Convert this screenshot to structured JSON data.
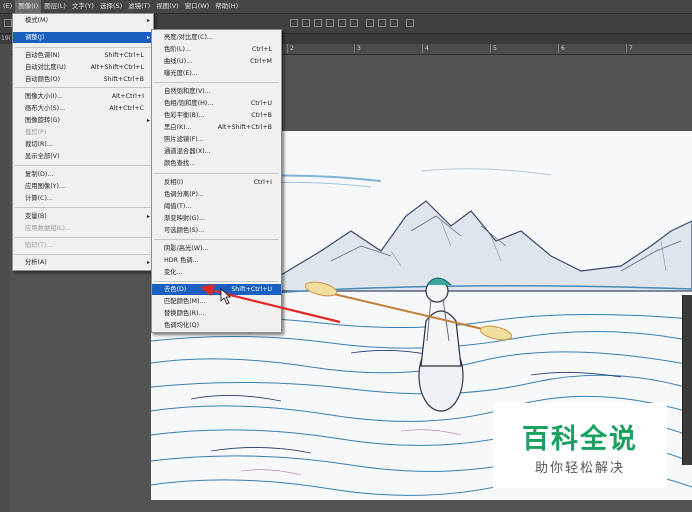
{
  "menubar": {
    "items": [
      {
        "label": "(E)"
      },
      {
        "label": "图像(I)"
      },
      {
        "label": "图层(L)"
      },
      {
        "label": "文字(Y)"
      },
      {
        "label": "选择(S)"
      },
      {
        "label": "滤镜(T)"
      },
      {
        "label": "视图(V)"
      },
      {
        "label": "窗口(W)"
      },
      {
        "label": "帮助(H)"
      }
    ]
  },
  "tab_label": "19(",
  "ruler_labels": [
    "2",
    "3",
    "4",
    "5",
    "6",
    "7"
  ],
  "image_menu": {
    "items": [
      {
        "label": "模式(M)",
        "shortcut": "",
        "submenu": true
      },
      {
        "label": "调整(J)",
        "shortcut": "",
        "submenu": true,
        "highlighted": true
      },
      {
        "label": "自动色调(N)",
        "shortcut": "Shift+Ctrl+L"
      },
      {
        "label": "自动对比度(U)",
        "shortcut": "Alt+Shift+Ctrl+L"
      },
      {
        "label": "自动颜色(O)",
        "shortcut": "Shift+Ctrl+B"
      },
      {
        "label": "图像大小(I)...",
        "shortcut": "Alt+Ctrl+I"
      },
      {
        "label": "画布大小(S)...",
        "shortcut": "Alt+Ctrl+C"
      },
      {
        "label": "图像旋转(G)",
        "shortcut": "",
        "submenu": true
      },
      {
        "label": "裁剪(P)",
        "shortcut": "",
        "disabled": true
      },
      {
        "label": "裁切(R)...",
        "shortcut": ""
      },
      {
        "label": "显示全部(V)",
        "shortcut": ""
      },
      {
        "label": "复制(D)...",
        "shortcut": ""
      },
      {
        "label": "应用图像(Y)...",
        "shortcut": ""
      },
      {
        "label": "计算(C)...",
        "shortcut": ""
      },
      {
        "label": "变量(B)",
        "shortcut": "",
        "submenu": true
      },
      {
        "label": "应用数据组(L)...",
        "shortcut": "",
        "disabled": true
      },
      {
        "label": "陷印(T)...",
        "shortcut": "",
        "disabled": true
      },
      {
        "label": "分析(A)",
        "shortcut": "",
        "submenu": true
      }
    ]
  },
  "adjust_menu": {
    "items": [
      {
        "label": "亮度/对比度(C)...",
        "shortcut": ""
      },
      {
        "label": "色阶(L)...",
        "shortcut": "Ctrl+L"
      },
      {
        "label": "曲线(U)...",
        "shortcut": "Ctrl+M"
      },
      {
        "label": "曝光度(E)...",
        "shortcut": ""
      },
      {
        "label": "自然饱和度(V)...",
        "shortcut": ""
      },
      {
        "label": "色相/饱和度(H)...",
        "shortcut": "Ctrl+U"
      },
      {
        "label": "色彩平衡(B)...",
        "shortcut": "Ctrl+B"
      },
      {
        "label": "黑白(K)...",
        "shortcut": "Alt+Shift+Ctrl+B"
      },
      {
        "label": "照片滤镜(F)...",
        "shortcut": ""
      },
      {
        "label": "通道混合器(X)...",
        "shortcut": ""
      },
      {
        "label": "颜色查找...",
        "shortcut": ""
      },
      {
        "label": "反相(I)",
        "shortcut": "Ctrl+I"
      },
      {
        "label": "色调分离(P)...",
        "shortcut": ""
      },
      {
        "label": "阈值(T)...",
        "shortcut": ""
      },
      {
        "label": "渐变映射(G)...",
        "shortcut": ""
      },
      {
        "label": "可选颜色(S)...",
        "shortcut": ""
      },
      {
        "label": "阴影/高光(W)...",
        "shortcut": ""
      },
      {
        "label": "HDR 色调...",
        "shortcut": ""
      },
      {
        "label": "变化...",
        "shortcut": ""
      },
      {
        "label": "去色(D)",
        "shortcut": "Shift+Ctrl+U",
        "highlighted": true
      },
      {
        "label": "匹配颜色(M)...",
        "shortcut": ""
      },
      {
        "label": "替换颜色(R)...",
        "shortcut": ""
      },
      {
        "label": "色调均化(Q)",
        "shortcut": ""
      }
    ]
  },
  "watermark": {
    "title": "百科全说",
    "subtitle": "助你轻松解决"
  },
  "colors": {
    "highlight": "#1a5fc0",
    "arrow": "#e02a2a",
    "watermark_green": "#1aa060"
  }
}
